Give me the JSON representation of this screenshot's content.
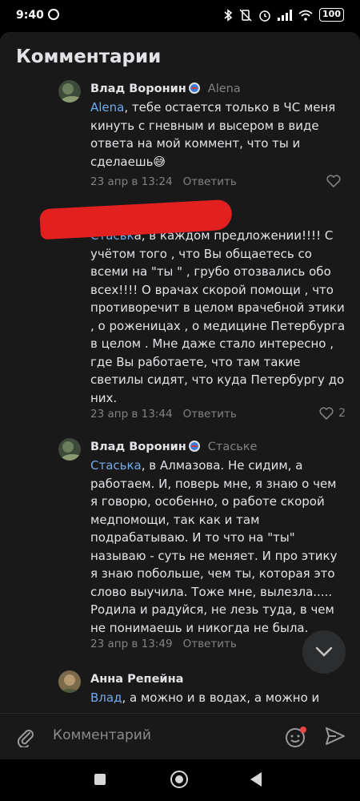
{
  "status_bar": {
    "time": "9:40",
    "battery": "100"
  },
  "sheet": {
    "title": "Комментарии"
  },
  "comments": [
    {
      "name": "Влад Воронин",
      "reply_to": "Alena",
      "mention": "Alena",
      "text": ", тебе остается только в ЧС меня кинуть с гневным и высером в виде ответа на мой коммент, что ты и сделаешь😅",
      "date": "23 апр в 13:24",
      "answer": "Ответить",
      "likes": ""
    },
    {
      "name": "",
      "reply_to": "",
      "mention": "Стаськ",
      "text": "а, в каждом предложении!!!! С учётом того , что Вы общаетесь со всеми на \"ты \" , грубо отозвались обо всех!!!! О врачах скорой помощи , что противоречит в целом врачебной этики , о роженицах , о медицине Петербурга в целом . Мне даже стало интересно , где Вы работаете, что там такие светилы сидят, что куда Петербургу до них.",
      "date": "23 апр в 13:44",
      "answer": "Ответить",
      "likes": "2"
    },
    {
      "name": "Влад Воронин",
      "reply_to": "Стаське",
      "mention": "Стаська",
      "text": ", в Алмазова. Не сидим, а работаем. И, поверь мне, я знаю о чем я говорю, особенно, о работе скорой медпомощи, так как и там подрабатываю. И то что на \"ты\" называю - суть не меняет. И про этику я знаю побольше, чем ты, которая это слово выучила. Тоже мне, вылезла..... Родила и радуйся, не лезь туда, в чем не понимаешь и никогда не была.",
      "date": "23 апр в 13:49",
      "answer": "Ответить",
      "likes": ""
    },
    {
      "name": "Анна Репейна",
      "reply_to": "",
      "mention": "Влад",
      "text": ", а можно и в водах, а можно и",
      "date": "",
      "answer": "",
      "likes": ""
    }
  ],
  "composer": {
    "placeholder": "Комментарий"
  },
  "icons": {
    "attach": "paperclip-icon",
    "emoji": "sticker-icon",
    "send": "send-icon",
    "scroll": "chevron-down-icon",
    "like": "heart-icon"
  },
  "colors": {
    "background": "#19191a",
    "mention": "#71aaeb",
    "secondary": "#828282",
    "accent": "#3a7bd5",
    "redaction": "#e2201f"
  }
}
